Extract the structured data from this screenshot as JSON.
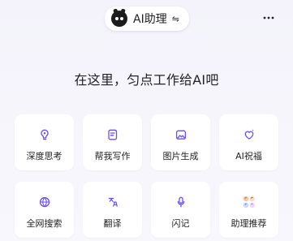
{
  "header": {
    "assistant_name": "AI助理",
    "switch_symbol": "⇋",
    "more_label": "⋯"
  },
  "main": {
    "headline": "在这里，匀点工作给AI吧"
  },
  "features": [
    {
      "label": "深度思考",
      "icon": "lightbulb-icon"
    },
    {
      "label": "帮我写作",
      "icon": "write-icon"
    },
    {
      "label": "图片生成",
      "icon": "image-generate-icon"
    },
    {
      "label": "AI祝福",
      "icon": "heart-sparkle-icon"
    },
    {
      "label": "全网搜索",
      "icon": "globe-icon"
    },
    {
      "label": "翻译",
      "icon": "translate-icon"
    },
    {
      "label": "闪记",
      "icon": "mic-icon"
    },
    {
      "label": "助理推荐",
      "icon": "assistant-avatars-icon"
    }
  ],
  "colors": {
    "accent": "#6a4cff",
    "background": "#f6f5fc",
    "card": "#ffffff",
    "text": "#222222"
  }
}
